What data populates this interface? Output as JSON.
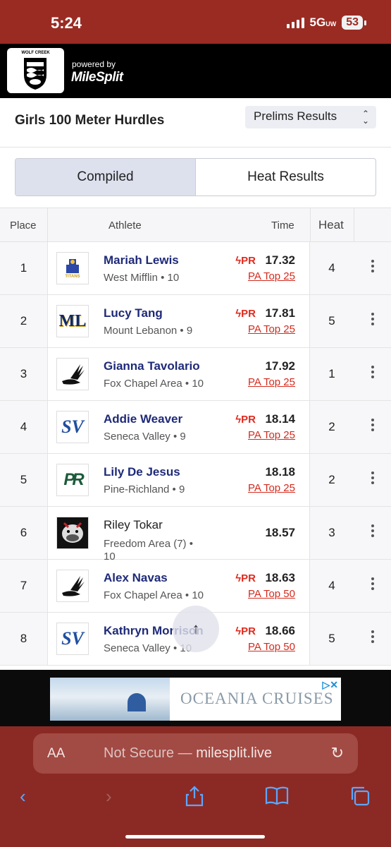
{
  "status": {
    "time": "5:24",
    "network": "5G",
    "network_sup": "UW",
    "battery": "53"
  },
  "brand": {
    "school_logo_text": "WOLF CREEK",
    "powered_by": "powered by",
    "name": "MileSplit"
  },
  "event": {
    "title": "Girls 100 Meter Hurdles",
    "round_selected": "Prelims Results"
  },
  "tabs": [
    {
      "label": "Compiled",
      "active": true
    },
    {
      "label": "Heat Results",
      "active": false
    }
  ],
  "table": {
    "headers": {
      "place": "Place",
      "athlete": "Athlete",
      "time": "Time",
      "heat": "Heat"
    },
    "rows": [
      {
        "place": "1",
        "name": "Mariah Lewis",
        "team": "West Mifflin • 10",
        "pr": "PR",
        "time": "17.32",
        "rank": "PA Top 25",
        "heat": "4",
        "logo": "TITANS"
      },
      {
        "place": "2",
        "name": "Lucy Tang",
        "team": "Mount Lebanon • 9",
        "pr": "PR",
        "time": "17.81",
        "rank": "PA Top 25",
        "heat": "5",
        "logo": "ML"
      },
      {
        "place": "3",
        "name": "Gianna Tavolario",
        "team": "Fox Chapel Area • 10",
        "pr": "",
        "time": "17.92",
        "rank": "PA Top 25",
        "heat": "1",
        "logo": "FC"
      },
      {
        "place": "4",
        "name": "Addie Weaver",
        "team": "Seneca Valley • 9",
        "pr": "PR",
        "time": "18.14",
        "rank": "PA Top 25",
        "heat": "2",
        "logo": "SV"
      },
      {
        "place": "5",
        "name": "Lily De Jesus",
        "team": "Pine-Richland • 9",
        "pr": "",
        "time": "18.18",
        "rank": "PA Top 25",
        "heat": "2",
        "logo": "PR"
      },
      {
        "place": "6",
        "name": "Riley Tokar",
        "team": "Freedom Area (7) • 10",
        "pr": "",
        "time": "18.57",
        "rank": "",
        "heat": "3",
        "logo": "FA"
      },
      {
        "place": "7",
        "name": "Alex Navas",
        "team": "Fox Chapel Area • 10",
        "pr": "PR",
        "time": "18.63",
        "rank": "PA Top 50",
        "heat": "4",
        "logo": "FC"
      },
      {
        "place": "8",
        "name": "Kathryn Morrison",
        "team": "Seneca Valley • 10",
        "pr": "PR",
        "time": "18.66",
        "rank": "PA Top 50",
        "heat": "5",
        "logo": "SV"
      }
    ]
  },
  "ad": {
    "brand": "OCEANIA CRUISES"
  },
  "browser": {
    "aa": "AA",
    "not_secure": "Not Secure",
    "dash": " — ",
    "domain": "milesplit.live"
  },
  "colors": {
    "brand_red": "#9a2b23",
    "link_blue": "#1e2a78",
    "pr_red": "#e02a1d"
  }
}
